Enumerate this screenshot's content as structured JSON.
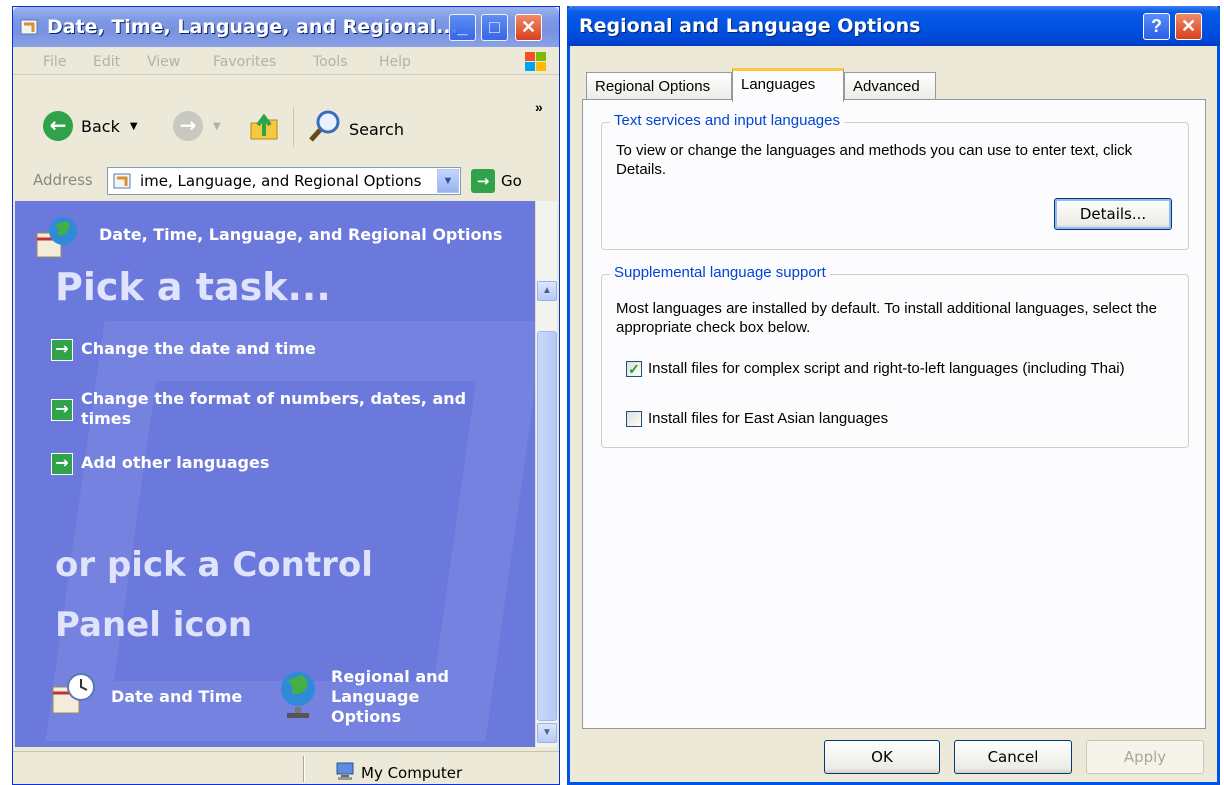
{
  "explorer": {
    "title": "Date, Time, Language, and Regional...",
    "menu": [
      "File",
      "Edit",
      "View",
      "Favorites",
      "Tools",
      "Help"
    ],
    "toolbar": {
      "back_label": "Back",
      "search_label": "Search",
      "more": "»"
    },
    "address": {
      "label": "Address",
      "value": "ime, Language, and Regional Options",
      "go_label": "Go"
    },
    "pane": {
      "header": "Date, Time, Language, and Regional Options",
      "pick_task": "Pick a task...",
      "tasks": [
        "Change the date and time",
        "Change the format of numbers, dates, and times",
        "Add other languages"
      ],
      "or_pick": "or pick a Control Panel icon",
      "icons": [
        {
          "label": "Date and Time",
          "icon": "clock-calendar-icon"
        },
        {
          "label": "Regional and Language Options",
          "icon": "globe-icon"
        }
      ]
    },
    "status": {
      "text": "My Computer"
    }
  },
  "dialog": {
    "title": "Regional and Language Options",
    "help_glyph": "?",
    "tabs": [
      {
        "label": "Regional Options",
        "active": false
      },
      {
        "label": "Languages",
        "active": true
      },
      {
        "label": "Advanced",
        "active": false
      }
    ],
    "text_services": {
      "title": "Text services and input languages",
      "description": "To view or change the languages and methods you can use to enter text, click Details.",
      "details_button": "Details..."
    },
    "supplemental": {
      "title": "Supplemental language support",
      "description": "Most languages are installed by default. To install additional languages, select the appropriate check box below.",
      "options": [
        {
          "label": "Install files for complex script and right-to-left languages (including Thai)",
          "checked": true
        },
        {
          "label": "Install files for East Asian languages",
          "checked": false
        }
      ]
    },
    "buttons": {
      "ok": "OK",
      "cancel": "Cancel",
      "apply": "Apply"
    }
  },
  "colors": {
    "xp_blue_title": "#0054e3",
    "control_panel_bg": "#6b79dc",
    "dialog_face": "#ece9d8",
    "group_title_blue": "#0046d5",
    "go_green": "#2fa24a"
  }
}
